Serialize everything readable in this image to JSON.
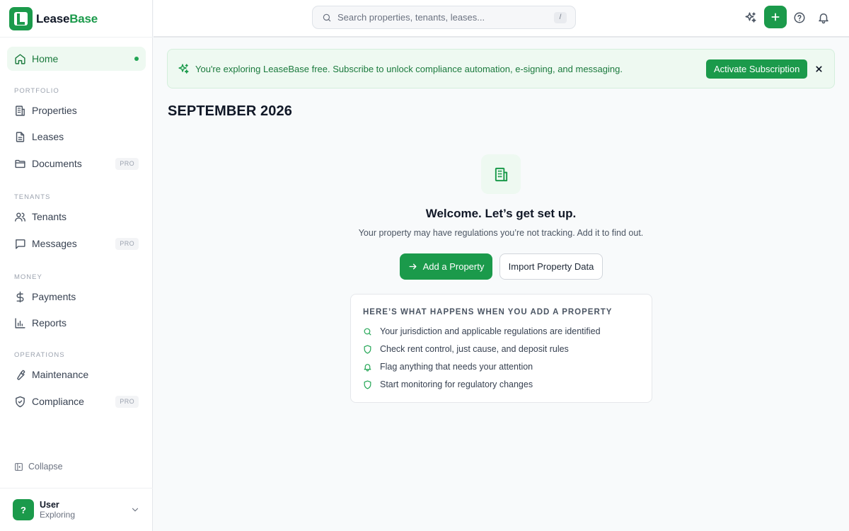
{
  "brand": {
    "name_part1": "Lease",
    "name_part2": "Base"
  },
  "sidebar": {
    "home": {
      "label": "Home"
    },
    "sections": {
      "portfolio": "PORTFOLIO",
      "tenants": "TENANTS",
      "money": "MONEY",
      "operations": "OPERATIONS"
    },
    "items": {
      "properties": "Properties",
      "leases": "Leases",
      "documents": "Documents",
      "tenants": "Tenants",
      "messages": "Messages",
      "payments": "Payments",
      "reports": "Reports",
      "maintenance": "Maintenance",
      "compliance": "Compliance"
    },
    "pro_badge": "PRO",
    "collapse_label": "Collapse",
    "user": {
      "avatar": "?",
      "name": "User",
      "status": "Exploring"
    }
  },
  "topbar": {
    "search_placeholder": "Search properties, tenants, leases...",
    "search_shortcut": "/"
  },
  "banner": {
    "text": "You're exploring LeaseBase free. Subscribe to unlock compliance automation, e-signing, and messaging.",
    "cta": "Activate Subscription"
  },
  "main": {
    "month": "SEPTEMBER 2026",
    "welcome_title": "Welcome. Let’s get set up.",
    "welcome_subtitle": "Your property may have regulations you’re not tracking. Add it to find out.",
    "primary_button": "Add a Property",
    "secondary_button": "Import Property Data",
    "card": {
      "title": "HERE’S WHAT HAPPENS WHEN YOU ADD A PROPERTY",
      "items": [
        {
          "icon": "search-icon",
          "text": "Your jurisdiction and applicable regulations are identified"
        },
        {
          "icon": "shield-icon",
          "text": "Check rent control, just cause, and deposit rules"
        },
        {
          "icon": "bell-icon",
          "text": "Flag anything that needs your attention"
        },
        {
          "icon": "shield-icon",
          "text": "Start monitoring for regulatory changes"
        }
      ]
    }
  },
  "colors": {
    "brand_green": "#1b9a4b",
    "light_green_bg": "#eef9f1",
    "text_dark": "#111827"
  }
}
